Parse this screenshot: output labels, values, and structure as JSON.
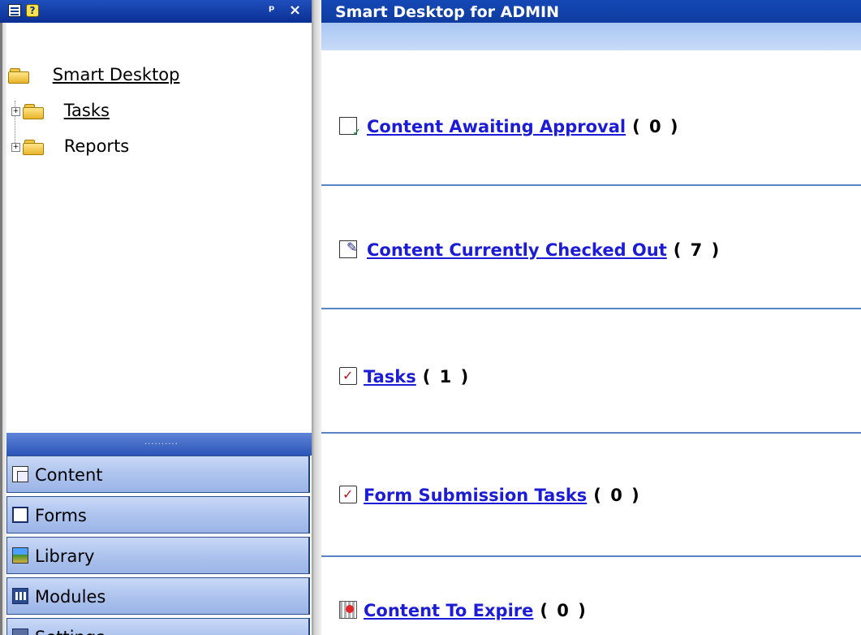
{
  "left_pane": {
    "header_pin": "ᵖ",
    "header_close": "×",
    "tree": {
      "root": "Smart Desktop",
      "children": [
        {
          "label": "Tasks",
          "expander": "+"
        },
        {
          "label": "Reports",
          "expander": "+"
        }
      ]
    },
    "splitter_grip": "..........",
    "nav_buttons": [
      {
        "label": "Content",
        "icon": "content-icon"
      },
      {
        "label": "Forms",
        "icon": "forms-icon"
      },
      {
        "label": "Library",
        "icon": "library-icon"
      },
      {
        "label": "Modules",
        "icon": "modules-icon"
      },
      {
        "label": "Settings",
        "icon": "settings-icon"
      }
    ]
  },
  "right_pane": {
    "title": "Smart Desktop for ADMIN",
    "items": [
      {
        "label": "Content Awaiting Approval",
        "count": "( 0 )",
        "icon": "approval-icon"
      },
      {
        "label": "Content Currently Checked Out",
        "count": "( 7 )",
        "icon": "checkout-icon"
      },
      {
        "label": "Tasks",
        "count": "( 1 )",
        "icon": "task-icon"
      },
      {
        "label": "Form Submission Tasks",
        "count": "( 0 )",
        "icon": "task-icon"
      },
      {
        "label": "Content To Expire",
        "count": "( 0 )",
        "icon": "expire-icon"
      }
    ]
  },
  "colors": {
    "header_blue": "#0e3b9f",
    "link_blue": "#1c1cd6",
    "section_line": "#5a84c8",
    "nav_button": "#aec4ee"
  }
}
